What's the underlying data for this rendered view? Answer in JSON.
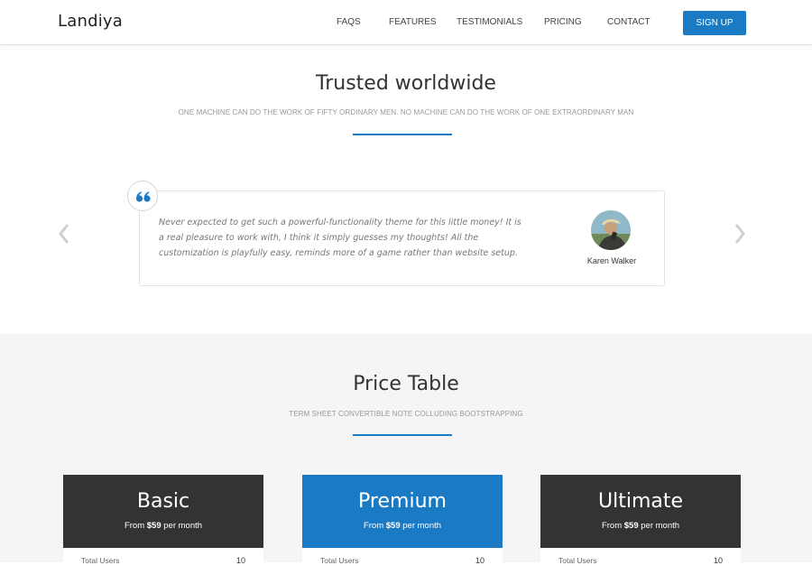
{
  "brand": "Landiya",
  "nav": [
    "FAQS",
    "FEATURES",
    "TESTIMONIALS",
    "PRICING",
    "CONTACT"
  ],
  "signup": "SIGN UP",
  "testimonials_section": {
    "title": "Trusted worldwide",
    "subtitle": "ONE MACHINE CAN DO THE WORK OF FIFTY ORDINARY MEN. NO MACHINE CAN DO THE WORK OF ONE EXTRAORDINARY MAN",
    "quote": "Never expected to get such a powerful-functionality theme for this little money! It is a real pleasure to work with, I think it simply guesses my thoughts! All the customization is playfully easy, reminds more of a game rather than website setup.",
    "author": "Karen Walker"
  },
  "pricing_section": {
    "title": "Price Table",
    "subtitle": "TERM SHEET CONVERTIBLE NOTE COLLUDING BOOTSTRAPPING",
    "plans": [
      {
        "name": "Basic",
        "from": "From",
        "price": "$59",
        "period": "per month",
        "row_label": "Total Users",
        "row_value": "10",
        "color": "#333333"
      },
      {
        "name": "Premium",
        "from": "From",
        "price": "$59",
        "period": "per month",
        "row_label": "Total Users",
        "row_value": "10",
        "color": "#1a7bc4"
      },
      {
        "name": "Ultimate",
        "from": "From",
        "price": "$59",
        "period": "per month",
        "row_label": "Total Users",
        "row_value": "10",
        "color": "#333333"
      }
    ]
  },
  "colors": {
    "accent": "#1a7bc4",
    "dark": "#333333"
  },
  "icons": {
    "quote": "quote-icon",
    "prev": "chevron-left-icon",
    "next": "chevron-right-icon"
  }
}
